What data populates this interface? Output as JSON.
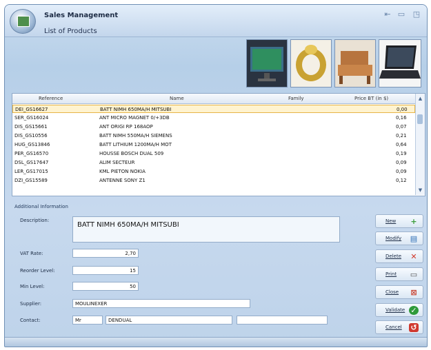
{
  "window": {
    "title": "Sales Management",
    "subtitle": "List of Products"
  },
  "products_grid": {
    "columns": [
      "Reference",
      "Name",
      "Family",
      "Price BT (in $)"
    ],
    "rows": [
      {
        "reference": "DEI_GS16627",
        "name": "BATT NIMH 650MA/H MITSUBI",
        "family": "",
        "price": "0,00"
      },
      {
        "reference": "SER_GS16024",
        "name": "ANT MICRO MAGNET 0/+3DB",
        "family": "",
        "price": "0,16"
      },
      {
        "reference": "DIS_GS15661",
        "name": "ANT ORIGI RP 168AOP",
        "family": "",
        "price": "0,07"
      },
      {
        "reference": "DIS_GS10556",
        "name": "BATT NIMH 550MA/H SIEMENS",
        "family": "",
        "price": "0,21"
      },
      {
        "reference": "HUG_GS13846",
        "name": "BATT LITHIUM 1200MA/H MOT",
        "family": "",
        "price": "0,64"
      },
      {
        "reference": "PER_GS16570",
        "name": "HOUSSE BOSCH DUAL 509",
        "family": "",
        "price": "0,19"
      },
      {
        "reference": "DSL_GS17647",
        "name": "ALIM SECTEUR",
        "family": "",
        "price": "0,09"
      },
      {
        "reference": "LER_GS17015",
        "name": "KML PIETON NOKIA",
        "family": "",
        "price": "0,09"
      },
      {
        "reference": "DZI_GS15589",
        "name": "ANTENNE SONY Z1",
        "family": "",
        "price": "0,12"
      }
    ]
  },
  "details": {
    "section_label": "Additional Information",
    "description_label": "Description:",
    "description_value": "BATT NIMH 650MA/H MITSUBI",
    "vat_label": "VAT Rate:",
    "vat_value": "2,70",
    "reorder_label": "Reorder Level:",
    "reorder_value": "15",
    "min_label": "Min Level:",
    "min_value": "50",
    "supplier_label": "Supplier:",
    "supplier_value": "MOULINEXER",
    "contact_label": "Contact:",
    "contact_title": "Mr",
    "contact_name": "DENDUAL",
    "contact_extra": ""
  },
  "buttons": {
    "new": "New",
    "modify": "Modify",
    "delete": "Delete",
    "print": "Print",
    "close": "Close",
    "validate": "Validate",
    "cancel": "Cancel"
  },
  "icons": {
    "app": "sales-app-icon",
    "minimize": "minimize-icon",
    "maximize": "maximize-icon",
    "restore": "restore-icon"
  },
  "colors": {
    "accent": "#c9dcef",
    "selection": "#fff3cf",
    "selection_border": "#e7b446"
  }
}
